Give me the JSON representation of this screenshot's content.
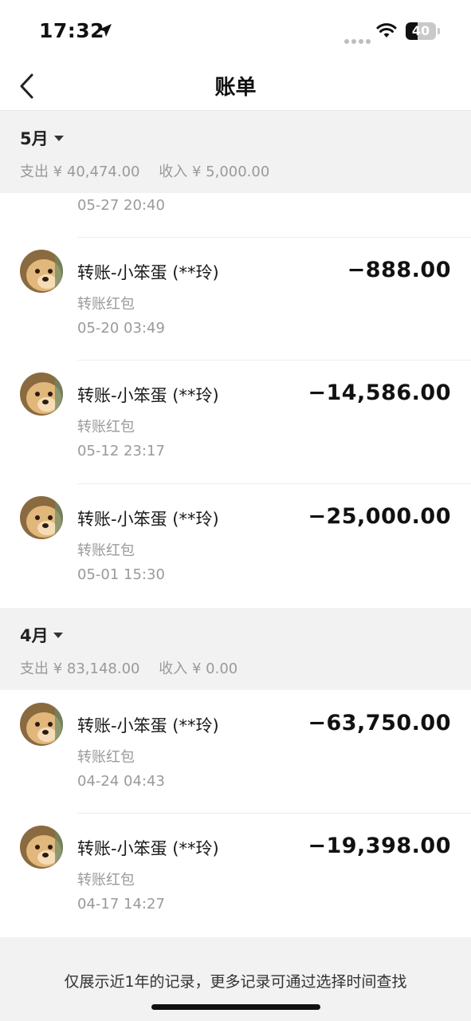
{
  "status_bar": {
    "time": "17:32",
    "battery": "40",
    "battery_level": 0.4
  },
  "nav": {
    "title": "账单"
  },
  "months": [
    {
      "label": "5月",
      "expense": "支出 ¥ 40,474.00",
      "income": "收入 ¥ 5,000.00",
      "partial_date": "05-27  20:40",
      "records": [
        {
          "name": "转账-小笨蛋 (**玲)",
          "type": "转账红包",
          "date": "05-20  03:49",
          "amount": "−888.00"
        },
        {
          "name": "转账-小笨蛋 (**玲)",
          "type": "转账红包",
          "date": "05-12  23:17",
          "amount": "−14,586.00"
        },
        {
          "name": "转账-小笨蛋 (**玲)",
          "type": "转账红包",
          "date": "05-01  15:30",
          "amount": "−25,000.00"
        }
      ]
    },
    {
      "label": "4月",
      "expense": "支出 ¥ 83,148.00",
      "income": "收入 ¥ 0.00",
      "records": [
        {
          "name": "转账-小笨蛋 (**玲)",
          "type": "转账红包",
          "date": "04-24  04:43",
          "amount": "−63,750.00"
        },
        {
          "name": "转账-小笨蛋 (**玲)",
          "type": "转账红包",
          "date": "04-17  14:27",
          "amount": "−19,398.00"
        }
      ]
    }
  ],
  "footer": {
    "note": "仅展示近1年的记录，更多记录可通过选择时间查找"
  },
  "icons": {
    "back": "chevron-left-icon",
    "caret": "caret-down-icon",
    "location": "location-arrow-icon",
    "wifi": "wifi-icon",
    "battery": "battery-icon",
    "avatar": "dog-avatar"
  },
  "colors": {
    "background": "#ffffff",
    "section_bg": "#f2f2f2",
    "secondary_text": "#9a9a9a",
    "primary_text": "#111111"
  }
}
